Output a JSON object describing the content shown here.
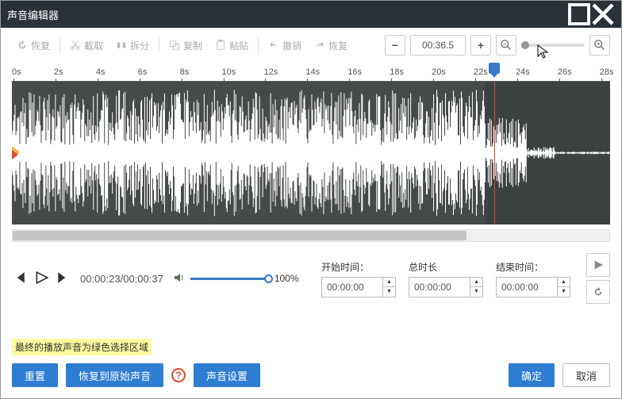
{
  "window": {
    "title": "声音编辑器"
  },
  "toolbar": {
    "restore": "恢复",
    "cut": "截取",
    "split": "拆分",
    "copy": "复制",
    "paste": "粘贴",
    "undo": "撤销",
    "redo": "恢复",
    "current_time": "00:36.5"
  },
  "ruler": {
    "ticks": [
      "0s",
      "2s",
      "4s",
      "6s",
      "8s",
      "10s",
      "12s",
      "14s",
      "16s",
      "18s",
      "20s",
      "22s",
      "24s",
      "26s",
      "28s"
    ],
    "marker_pos_s": 23
  },
  "playback": {
    "position": "00:00:23/00:00:37",
    "volume_pct": "100%"
  },
  "fields": {
    "start_label": "开始时间：",
    "duration_label": "总时长",
    "end_label": "结束时间：",
    "start_value": "00:00:00",
    "duration_value": "00:00:00",
    "end_value": "00:00:00"
  },
  "hint": "最终的播放声音为绿色选择区域",
  "buttons": {
    "reset": "重置",
    "restore_original": "恢复到原始声音",
    "sound_settings": "声音设置",
    "ok": "确定",
    "cancel": "取消"
  }
}
